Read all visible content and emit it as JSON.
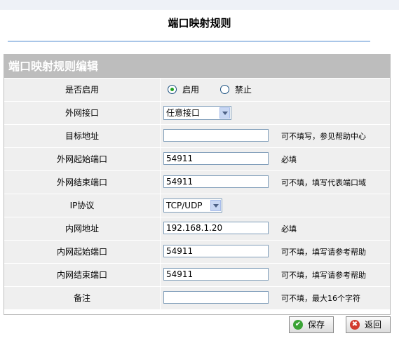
{
  "page": {
    "title": "端口映射规则"
  },
  "form": {
    "header": "端口映射规则编辑",
    "enable": {
      "label": "是否启用",
      "on_label": "启用",
      "off_label": "禁止",
      "selected": "启用"
    },
    "wan_interface": {
      "label": "外网接口",
      "value": "任意接口"
    },
    "target_address": {
      "label": "目标地址",
      "value": "",
      "hint": "可不填写，参见帮助中心"
    },
    "wan_start_port": {
      "label": "外网起始端口",
      "value": "54911",
      "hint": "必填"
    },
    "wan_end_port": {
      "label": "外网结束端口",
      "value": "54911",
      "hint": "可不填，填写代表端口域"
    },
    "protocol": {
      "label": "IP协议",
      "value": "TCP/UDP"
    },
    "lan_address": {
      "label": "内网地址",
      "value": "192.168.1.20",
      "hint": "必填"
    },
    "lan_start_port": {
      "label": "内网起始端口",
      "value": "54911",
      "hint": "可不填，填写请参考帮助"
    },
    "lan_end_port": {
      "label": "内网结束端口",
      "value": "54911",
      "hint": "可不填，填写请参考帮助"
    },
    "remark": {
      "label": "备注",
      "value": "",
      "hint": "可不填，最大16个字符"
    }
  },
  "buttons": {
    "save_label": "保存",
    "save_icon": "check-icon",
    "back_label": "返回",
    "back_icon": "cross-icon"
  },
  "colors": {
    "header_bg": "#bdbdbd",
    "row_bg": "#efefef",
    "title_rule": "#a9c6e8",
    "input_border": "#7f9db9"
  }
}
